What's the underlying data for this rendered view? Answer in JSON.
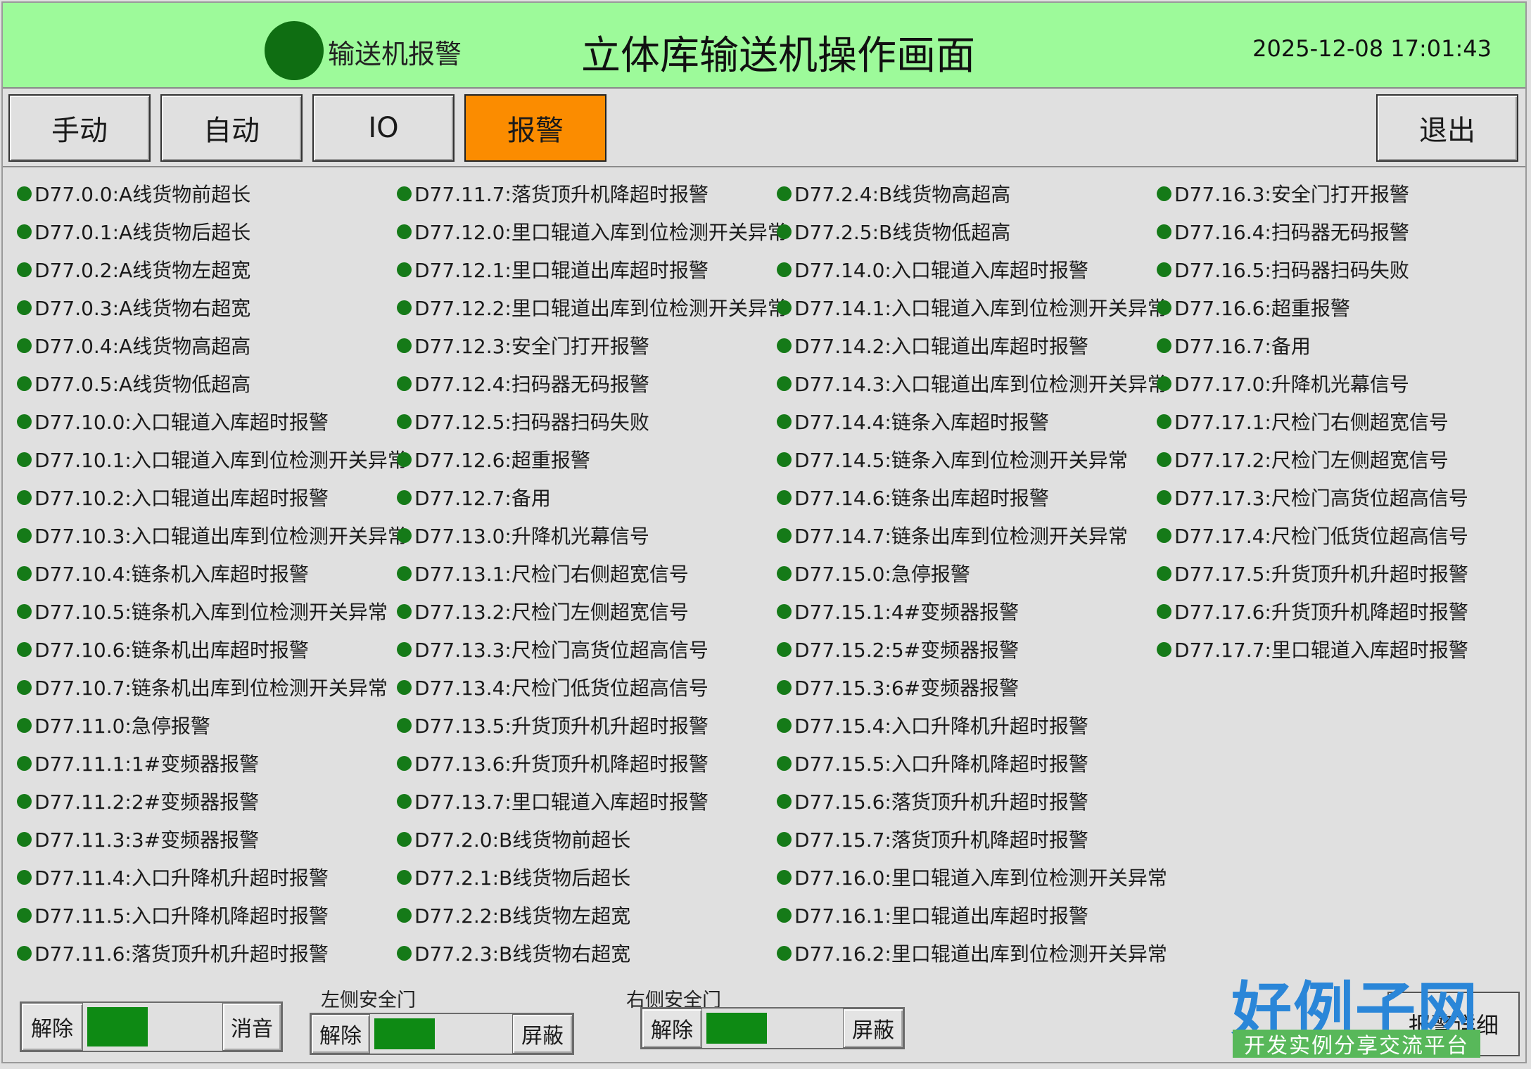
{
  "header": {
    "alarm_indicator_label": "输送机报警",
    "title": "立体库输送机操作画面",
    "datetime": "2025-12-08 17:01:43",
    "background_color": "#9dfa9a"
  },
  "nav": {
    "manual": "手动",
    "auto": "自动",
    "io": "IO",
    "alarm": "报警",
    "exit": "退出",
    "active_color": "#fb8c00"
  },
  "alarms": {
    "col1": [
      "D77.0.0:A线货物前超长",
      "D77.0.1:A线货物后超长",
      "D77.0.2:A线货物左超宽",
      "D77.0.3:A线货物右超宽",
      "D77.0.4:A线货物高超高",
      "D77.0.5:A线货物低超高",
      "D77.10.0:入口辊道入库超时报警",
      "D77.10.1:入口辊道入库到位检测开关异常",
      "D77.10.2:入口辊道出库超时报警",
      "D77.10.3:入口辊道出库到位检测开关异常",
      "D77.10.4:链条机入库超时报警",
      "D77.10.5:链条机入库到位检测开关异常",
      "D77.10.6:链条机出库超时报警",
      "D77.10.7:链条机出库到位检测开关异常",
      "D77.11.0:急停报警",
      "D77.11.1:1#变频器报警",
      "D77.11.2:2#变频器报警",
      "D77.11.3:3#变频器报警",
      "D77.11.4:入口升降机升超时报警",
      "D77.11.5:入口升降机降超时报警",
      "D77.11.6:落货顶升机升超时报警"
    ],
    "col2": [
      "D77.11.7:落货顶升机降超时报警",
      "D77.12.0:里口辊道入库到位检测开关异常",
      "D77.12.1:里口辊道出库超时报警",
      "D77.12.2:里口辊道出库到位检测开关异常",
      "D77.12.3:安全门打开报警",
      "D77.12.4:扫码器无码报警",
      "D77.12.5:扫码器扫码失败",
      "D77.12.6:超重报警",
      "D77.12.7:备用",
      "D77.13.0:升降机光幕信号",
      "D77.13.1:尺检门右侧超宽信号",
      "D77.13.2:尺检门左侧超宽信号",
      "D77.13.3:尺检门高货位超高信号",
      "D77.13.4:尺检门低货位超高信号",
      "D77.13.5:升货顶升机升超时报警",
      "D77.13.6:升货顶升机降超时报警",
      "D77.13.7:里口辊道入库超时报警",
      "D77.2.0:B线货物前超长",
      "D77.2.1:B线货物后超长",
      "D77.2.2:B线货物左超宽",
      "D77.2.3:B线货物右超宽"
    ],
    "col3": [
      "D77.2.4:B线货物高超高",
      "D77.2.5:B线货物低超高",
      "D77.14.0:入口辊道入库超时报警",
      "D77.14.1:入口辊道入库到位检测开关异常",
      "D77.14.2:入口辊道出库超时报警",
      "D77.14.3:入口辊道出库到位检测开关异常",
      "D77.14.4:链条入库超时报警",
      "D77.14.5:链条入库到位检测开关异常",
      "D77.14.6:链条出库超时报警",
      "D77.14.7:链条出库到位检测开关异常",
      "D77.15.0:急停报警",
      "D77.15.1:4#变频器报警",
      "D77.15.2:5#变频器报警",
      "D77.15.3:6#变频器报警",
      "D77.15.4:入口升降机升超时报警",
      "D77.15.5:入口升降机降超时报警",
      "D77.15.6:落货顶升机升超时报警",
      "D77.15.7:落货顶升机降超时报警",
      "D77.16.0:里口辊道入库到位检测开关异常",
      "D77.16.1:里口辊道出库超时报警",
      "D77.16.2:里口辊道出库到位检测开关异常"
    ],
    "col4": [
      "D77.16.3:安全门打开报警",
      "D77.16.4:扫码器无码报警",
      "D77.16.5:扫码器扫码失败",
      "D77.16.6:超重报警",
      "D77.16.7:备用",
      "D77.17.0:升降机光幕信号",
      "D77.17.1:尺检门右侧超宽信号",
      "D77.17.2:尺检门左侧超宽信号",
      "D77.17.3:尺检门高货位超高信号",
      "D77.17.4:尺检门低货位超高信号",
      "D77.17.5:升货顶升机升超时报警",
      "D77.17.6:升货顶升机降超时报警",
      "D77.17.7:里口辊道入库超时报警"
    ],
    "indicator_color": "#157a18"
  },
  "bottom": {
    "reset_panel": {
      "release": "解除",
      "silence": "消音"
    },
    "left_door": {
      "label": "左侧安全门",
      "release": "解除",
      "shield": "屏蔽"
    },
    "right_door": {
      "label": "右侧安全门",
      "release": "解除",
      "shield": "屏蔽"
    },
    "alarm_detail": "报警详细",
    "status_color": "#0e8a14"
  },
  "watermark": {
    "logo_text": "好例子网",
    "logo_subtitle": "开发实例分享交流平台"
  }
}
